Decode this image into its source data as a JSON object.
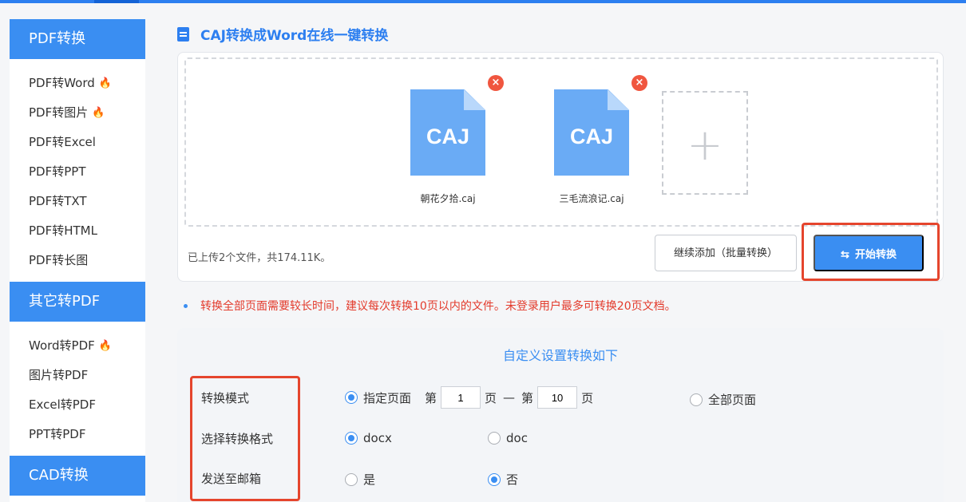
{
  "sidebar": {
    "sections": [
      {
        "title": "PDF转换",
        "items": [
          {
            "label": "PDF转Word",
            "hot": true
          },
          {
            "label": "PDF转图片",
            "hot": true
          },
          {
            "label": "PDF转Excel",
            "hot": false
          },
          {
            "label": "PDF转PPT",
            "hot": false
          },
          {
            "label": "PDF转TXT",
            "hot": false
          },
          {
            "label": "PDF转HTML",
            "hot": false
          },
          {
            "label": "PDF转长图",
            "hot": false
          }
        ]
      },
      {
        "title": "其它转PDF",
        "items": [
          {
            "label": "Word转PDF",
            "hot": true
          },
          {
            "label": "图片转PDF",
            "hot": false
          },
          {
            "label": "Excel转PDF",
            "hot": false
          },
          {
            "label": "PPT转PDF",
            "hot": false
          }
        ]
      },
      {
        "title": "CAD转换",
        "items": []
      }
    ]
  },
  "main": {
    "title": "CAJ转换成Word在线一键转换",
    "files": [
      {
        "type": "CAJ",
        "name": "朝花夕拾.caj"
      },
      {
        "type": "CAJ",
        "name": "三毛流浪记.caj"
      }
    ],
    "remove_symbol": "×",
    "add_symbol": "+",
    "summary": "已上传2个文件，共174.11K。",
    "continue_button": "继续添加（批量转换）",
    "start_button": "开始转换",
    "start_icon": "⇆",
    "notice": "转换全部页面需要较长时间，建议每次转换10页以内的文件。未登录用户最多可转换20页文档。"
  },
  "settings": {
    "title": "自定义设置转换如下",
    "mode": {
      "label": "转换模式",
      "specified": "指定页面",
      "from_text": "第",
      "from_page": "1",
      "to_text": "页",
      "dash": "—",
      "to_prefix": "第",
      "to_page": "10",
      "to_suffix": "页",
      "all_pages": "全部页面",
      "selected": "specified"
    },
    "format": {
      "label": "选择转换格式",
      "options": [
        "docx",
        "doc"
      ],
      "selected": "docx"
    },
    "email": {
      "label": "发送至邮箱",
      "yes": "是",
      "no": "否",
      "selected": "no"
    }
  },
  "colors": {
    "brand": "#3a8ef2",
    "notice": "#e33a2b",
    "highlight_box": "#e5452d",
    "fire": "#f5683a"
  },
  "icons": {
    "fire": "fire-icon",
    "title": "document-icon",
    "start": "swap-icon"
  }
}
